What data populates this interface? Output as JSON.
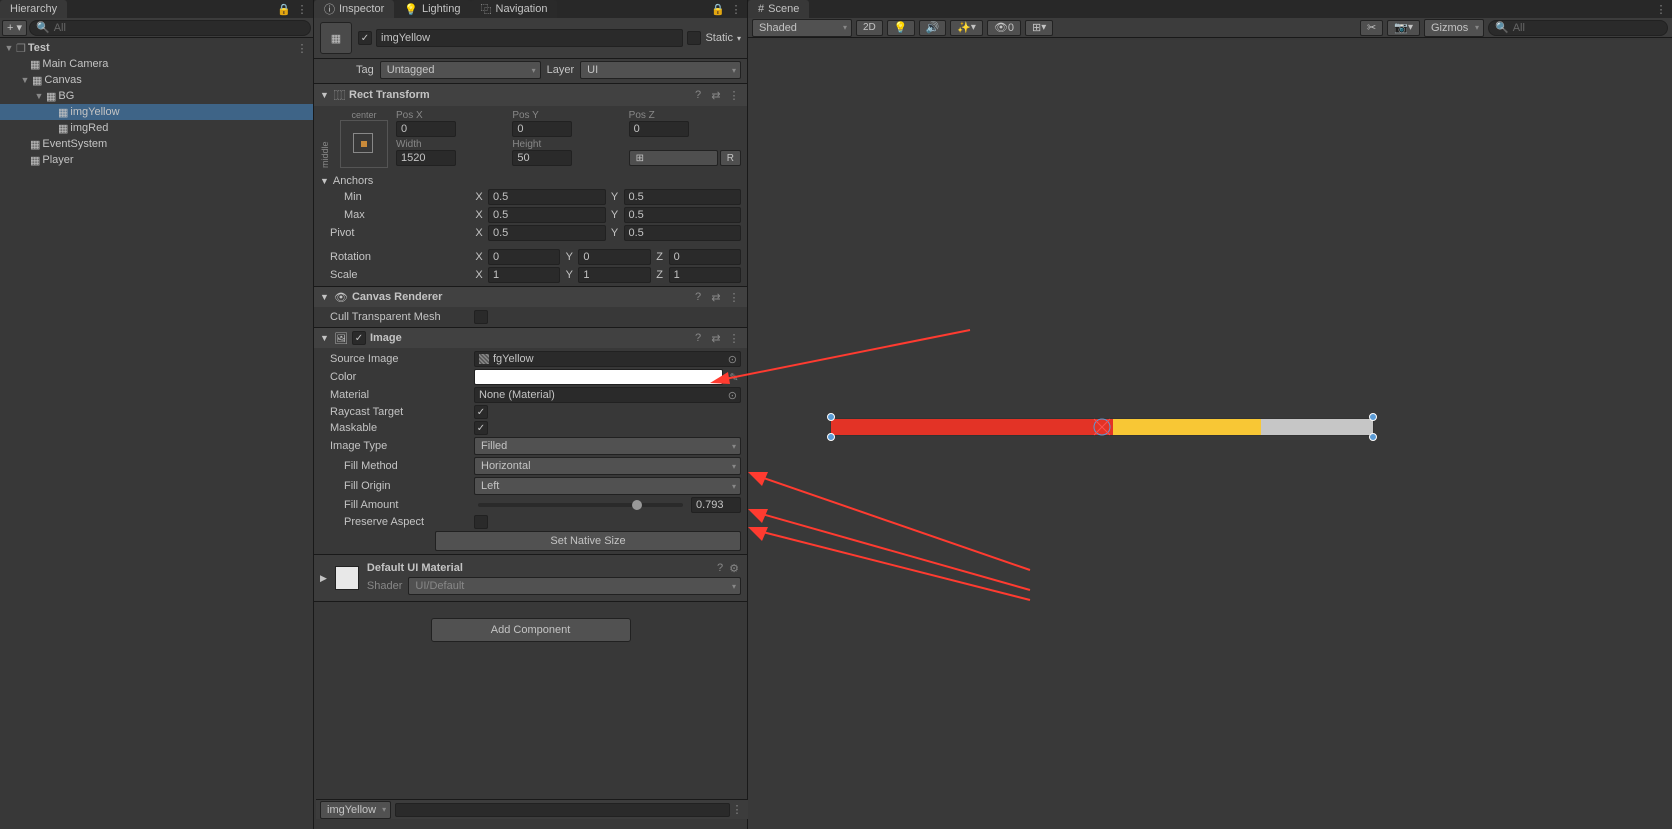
{
  "hierarchy": {
    "tab": "Hierarchy",
    "search_placeholder": "All",
    "scene": "Test",
    "items": [
      "Main Camera",
      "Canvas",
      "BG",
      "imgYellow",
      "imgRed",
      "EventSystem",
      "Player"
    ]
  },
  "inspector": {
    "tabs": [
      "Inspector",
      "Lighting",
      "Navigation"
    ],
    "object_name": "imgYellow",
    "static_label": "Static",
    "tag_label": "Tag",
    "tag_value": "Untagged",
    "layer_label": "Layer",
    "layer_value": "UI",
    "rect_transform": {
      "title": "Rect Transform",
      "anchor_label_v": "middle",
      "anchor_label_h": "center",
      "pos_x_label": "Pos X",
      "pos_x": "0",
      "pos_y_label": "Pos Y",
      "pos_y": "0",
      "pos_z_label": "Pos Z",
      "pos_z": "0",
      "width_label": "Width",
      "width": "1520",
      "height_label": "Height",
      "height": "50",
      "anchors_label": "Anchors",
      "min_label": "Min",
      "min_x": "0.5",
      "min_y": "0.5",
      "max_label": "Max",
      "max_x": "0.5",
      "max_y": "0.5",
      "pivot_label": "Pivot",
      "pivot_x": "0.5",
      "pivot_y": "0.5",
      "rotation_label": "Rotation",
      "rot_x": "0",
      "rot_y": "0",
      "rot_z": "0",
      "scale_label": "Scale",
      "scale_x": "1",
      "scale_y": "1",
      "scale_z": "1",
      "r_btn": "R"
    },
    "canvas_renderer": {
      "title": "Canvas Renderer",
      "cull_label": "Cull Transparent Mesh"
    },
    "image": {
      "title": "Image",
      "source_label": "Source Image",
      "source_value": "fgYellow",
      "color_label": "Color",
      "material_label": "Material",
      "material_value": "None (Material)",
      "raycast_label": "Raycast Target",
      "maskable_label": "Maskable",
      "type_label": "Image Type",
      "type_value": "Filled",
      "fill_method_label": "Fill Method",
      "fill_method_value": "Horizontal",
      "fill_origin_label": "Fill Origin",
      "fill_origin_value": "Left",
      "fill_amount_label": "Fill Amount",
      "fill_amount_value": "0.793",
      "preserve_label": "Preserve Aspect",
      "set_native_btn": "Set Native Size"
    },
    "material": {
      "title": "Default UI Material",
      "shader_label": "Shader",
      "shader_value": "UI/Default"
    },
    "add_component": "Add Component",
    "footer": "imgYellow"
  },
  "scene": {
    "tab": "Scene",
    "shading": "Shaded",
    "btn_2d": "2D",
    "hidden_count": "0",
    "gizmos": "Gizmos",
    "search_placeholder": "All"
  }
}
